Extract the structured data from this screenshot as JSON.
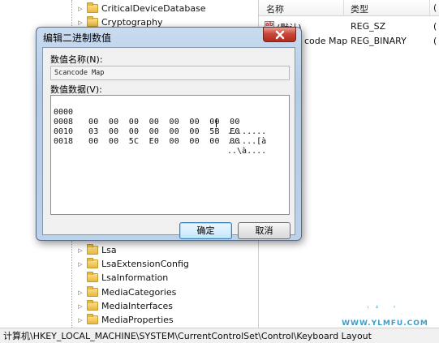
{
  "tree": {
    "items": [
      {
        "label": "CriticalDeviceDatabase",
        "has_children": true
      },
      {
        "label": "Cryptography",
        "has_children": true
      },
      {
        "label": "Lsa",
        "has_children": true
      },
      {
        "label": "LsaExtensionConfig",
        "has_children": true
      },
      {
        "label": "LsaInformation",
        "has_children": false
      },
      {
        "label": "MediaCategories",
        "has_children": true
      },
      {
        "label": "MediaInterfaces",
        "has_children": true
      },
      {
        "label": "MediaProperties",
        "has_children": true
      }
    ]
  },
  "list": {
    "columns": {
      "name": "名称",
      "type": "类型",
      "data": "("
    },
    "rows": [
      {
        "name": "(默认)",
        "type": "REG_SZ",
        "data": "("
      },
      {
        "name": "code Map",
        "type": "REG_BINARY",
        "data": "("
      }
    ]
  },
  "status_bar": {
    "path": "计算机\\HKEY_LOCAL_MACHINE\\SYSTEM\\CurrentControlSet\\Control\\Keyboard Layout"
  },
  "dialog": {
    "title": "编辑二进制数值",
    "name_label": "数值名称(N):",
    "name_value": "Scancode Map",
    "data_label": "数值数据(V):",
    "hex_rows": [
      {
        "offset": "0000",
        "bytes": "00  00  00  00  00  00  00  00",
        "ascii": "........"
      },
      {
        "offset": "0008",
        "bytes": "03  00  00  00  00  00  5B  E0",
        "ascii": "......[à"
      },
      {
        "offset": "0010",
        "bytes": "00  00  5C  E0  00  00  00  00",
        "ascii": "..\\à...."
      },
      {
        "offset": "0018",
        "bytes": "",
        "ascii": ""
      }
    ],
    "ok_label": "确定",
    "cancel_label": "取消"
  },
  "watermark": {
    "main": "雨林木风",
    "url": "WWW.YLMFU.COM"
  },
  "colors": {
    "dialog_frame": "#b4cbe6",
    "close_button": "#c9483a",
    "ok_button_border": "#3c7fb1",
    "watermark": "#6fc3e0"
  }
}
